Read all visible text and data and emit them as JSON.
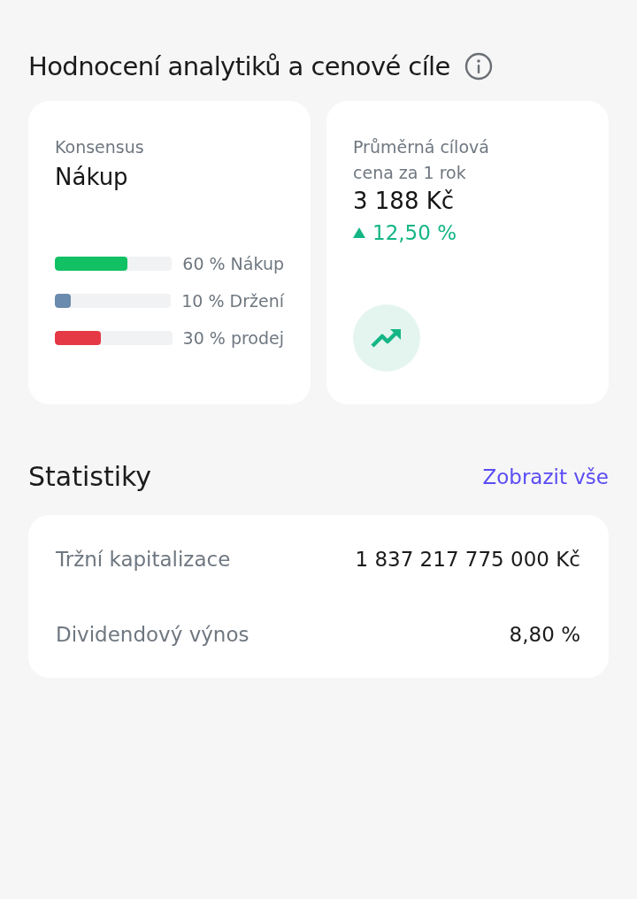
{
  "header": {
    "title": "Hodnocení analytiků a cenové cíle"
  },
  "consensus": {
    "label": "Konsensus",
    "value": "Nákup",
    "bars": [
      {
        "label": "60 % Nákup",
        "level": 0.62,
        "color": "#12c164"
      },
      {
        "label": "10 % Držení",
        "level": 0.14,
        "color": "#6a8bad"
      },
      {
        "label": "30 % prodej",
        "level": 0.39,
        "color": "#e53945"
      }
    ]
  },
  "target": {
    "label": "Průměrná cílová cena za 1 rok",
    "value": "3 188 Kč",
    "change": "12,50 %",
    "rising": true
  },
  "statistics": {
    "title": "Statistiky",
    "link": "Zobrazit vše",
    "rows": [
      {
        "label": "Tržní kapitalizace",
        "value": "1 837 217 775 000 Kč"
      },
      {
        "label": "Dividendový výnos",
        "value": "8,80 %"
      }
    ]
  }
}
